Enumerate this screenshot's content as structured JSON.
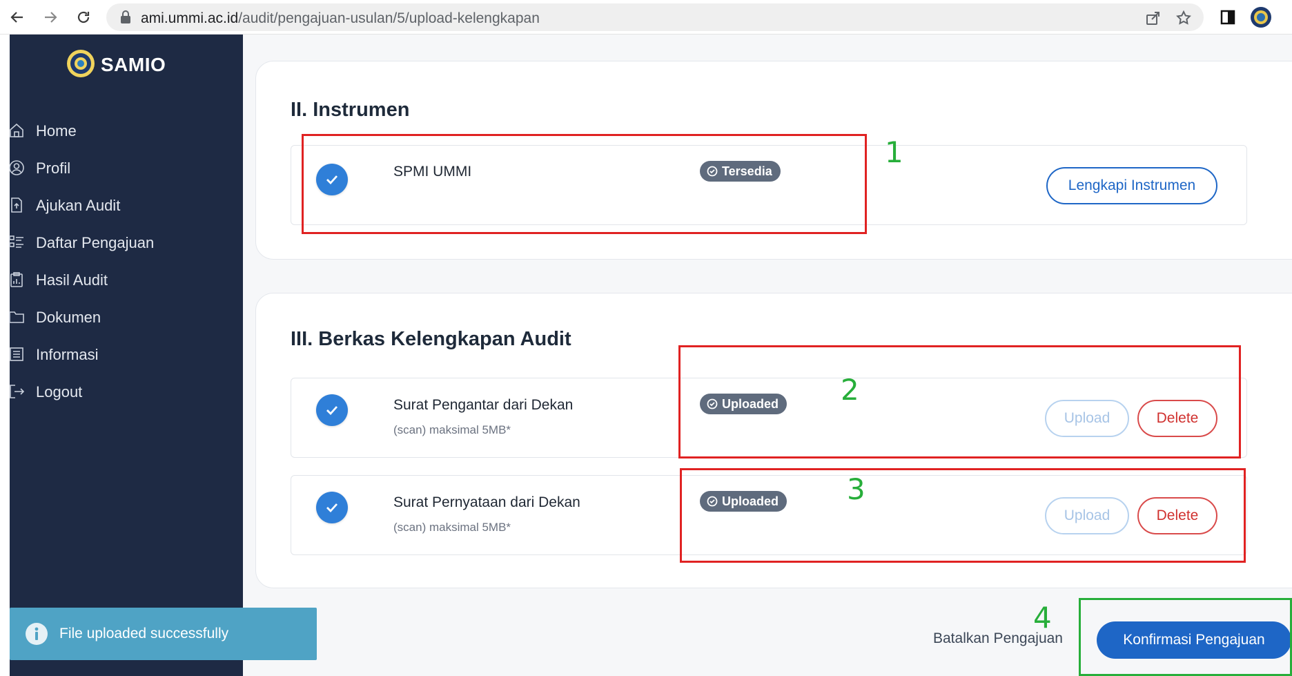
{
  "browser": {
    "url_host": "ami.ummi.ac.id",
    "url_path": "/audit/pengajuan-usulan/5/upload-kelengkapan"
  },
  "sidebar": {
    "brand": "SAMIO",
    "items": [
      {
        "label": "Home",
        "icon": "home-icon"
      },
      {
        "label": "Profil",
        "icon": "user-circle-icon"
      },
      {
        "label": "Ajukan Audit",
        "icon": "file-upload-icon"
      },
      {
        "label": "Daftar Pengajuan",
        "icon": "list-icon"
      },
      {
        "label": "Hasil Audit",
        "icon": "clipboard-chart-icon"
      },
      {
        "label": "Dokumen",
        "icon": "folder-icon"
      },
      {
        "label": "Informasi",
        "icon": "document-lines-icon"
      },
      {
        "label": "Logout",
        "icon": "logout-icon"
      }
    ]
  },
  "instrumen": {
    "title": "II. Instrumen",
    "item_name": "SPMI UMMI",
    "badge": "Tersedia",
    "action": "Lengkapi Instrumen"
  },
  "berkas": {
    "title": "III. Berkas Kelengkapan Audit",
    "items": [
      {
        "name": "Surat Pengantar dari Dekan",
        "note": "(scan) maksimal 5MB*",
        "badge": "Uploaded",
        "upload_label": "Upload",
        "delete_label": "Delete"
      },
      {
        "name": "Surat Pernyataan dari Dekan",
        "note": "(scan) maksimal 5MB*",
        "badge": "Uploaded",
        "upload_label": "Upload",
        "delete_label": "Delete"
      }
    ]
  },
  "footer": {
    "cancel_label": "Batalkan Pengajuan",
    "confirm_label": "Konfirmasi Pengajuan"
  },
  "annotations": {
    "n1": "1",
    "n2": "2",
    "n3": "3",
    "n4": "4"
  },
  "toast": {
    "message": "File uploaded successfully"
  },
  "colors": {
    "sidebar_bg": "#1e2a44",
    "primary": "#1e66c6",
    "danger": "#d0312f",
    "badge": "#5f6b7d",
    "annotation_red": "#e02222",
    "annotation_green": "#27ae3a",
    "toast": "#4fa3c5"
  }
}
